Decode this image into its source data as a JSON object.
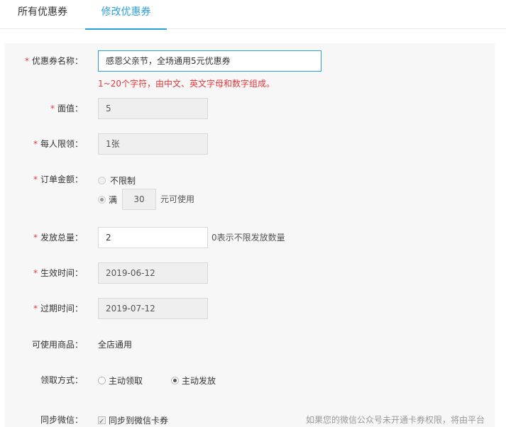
{
  "tabs": [
    {
      "label": "所有优惠券"
    },
    {
      "label": "修改优惠券"
    }
  ],
  "form": {
    "required_mark": "*",
    "name": {
      "label": "优惠券名称：",
      "value": "感恩父亲节，全场通用5元优惠券",
      "error": "1~20个字符，由中文、英文字母和数字组成。"
    },
    "face_value": {
      "label": "面值：",
      "value": "5"
    },
    "per_limit": {
      "label": "每人限领：",
      "value": "1张"
    },
    "order_amount": {
      "label": "订单金额：",
      "option_unlimited": "不限制",
      "option_full": "满",
      "full_value": "30",
      "full_suffix": "元可使用"
    },
    "total": {
      "label": "发放总量：",
      "value": "2",
      "hint": "0表示不限发放数量"
    },
    "start_time": {
      "label": "生效时间：",
      "value": "2019-06-12"
    },
    "end_time": {
      "label": "过期时间：",
      "value": "2019-07-12"
    },
    "goods": {
      "label": "可使用商品：",
      "value": "全店通用"
    },
    "method": {
      "label": "领取方式：",
      "option_active": "主动领取",
      "option_push": "主动发放"
    },
    "wechat": {
      "label": "同步微信：",
      "checkbox_label": "同步到微信卡券",
      "hint": "如果您的微信公众号未开通卡券权限，将由平台"
    }
  }
}
